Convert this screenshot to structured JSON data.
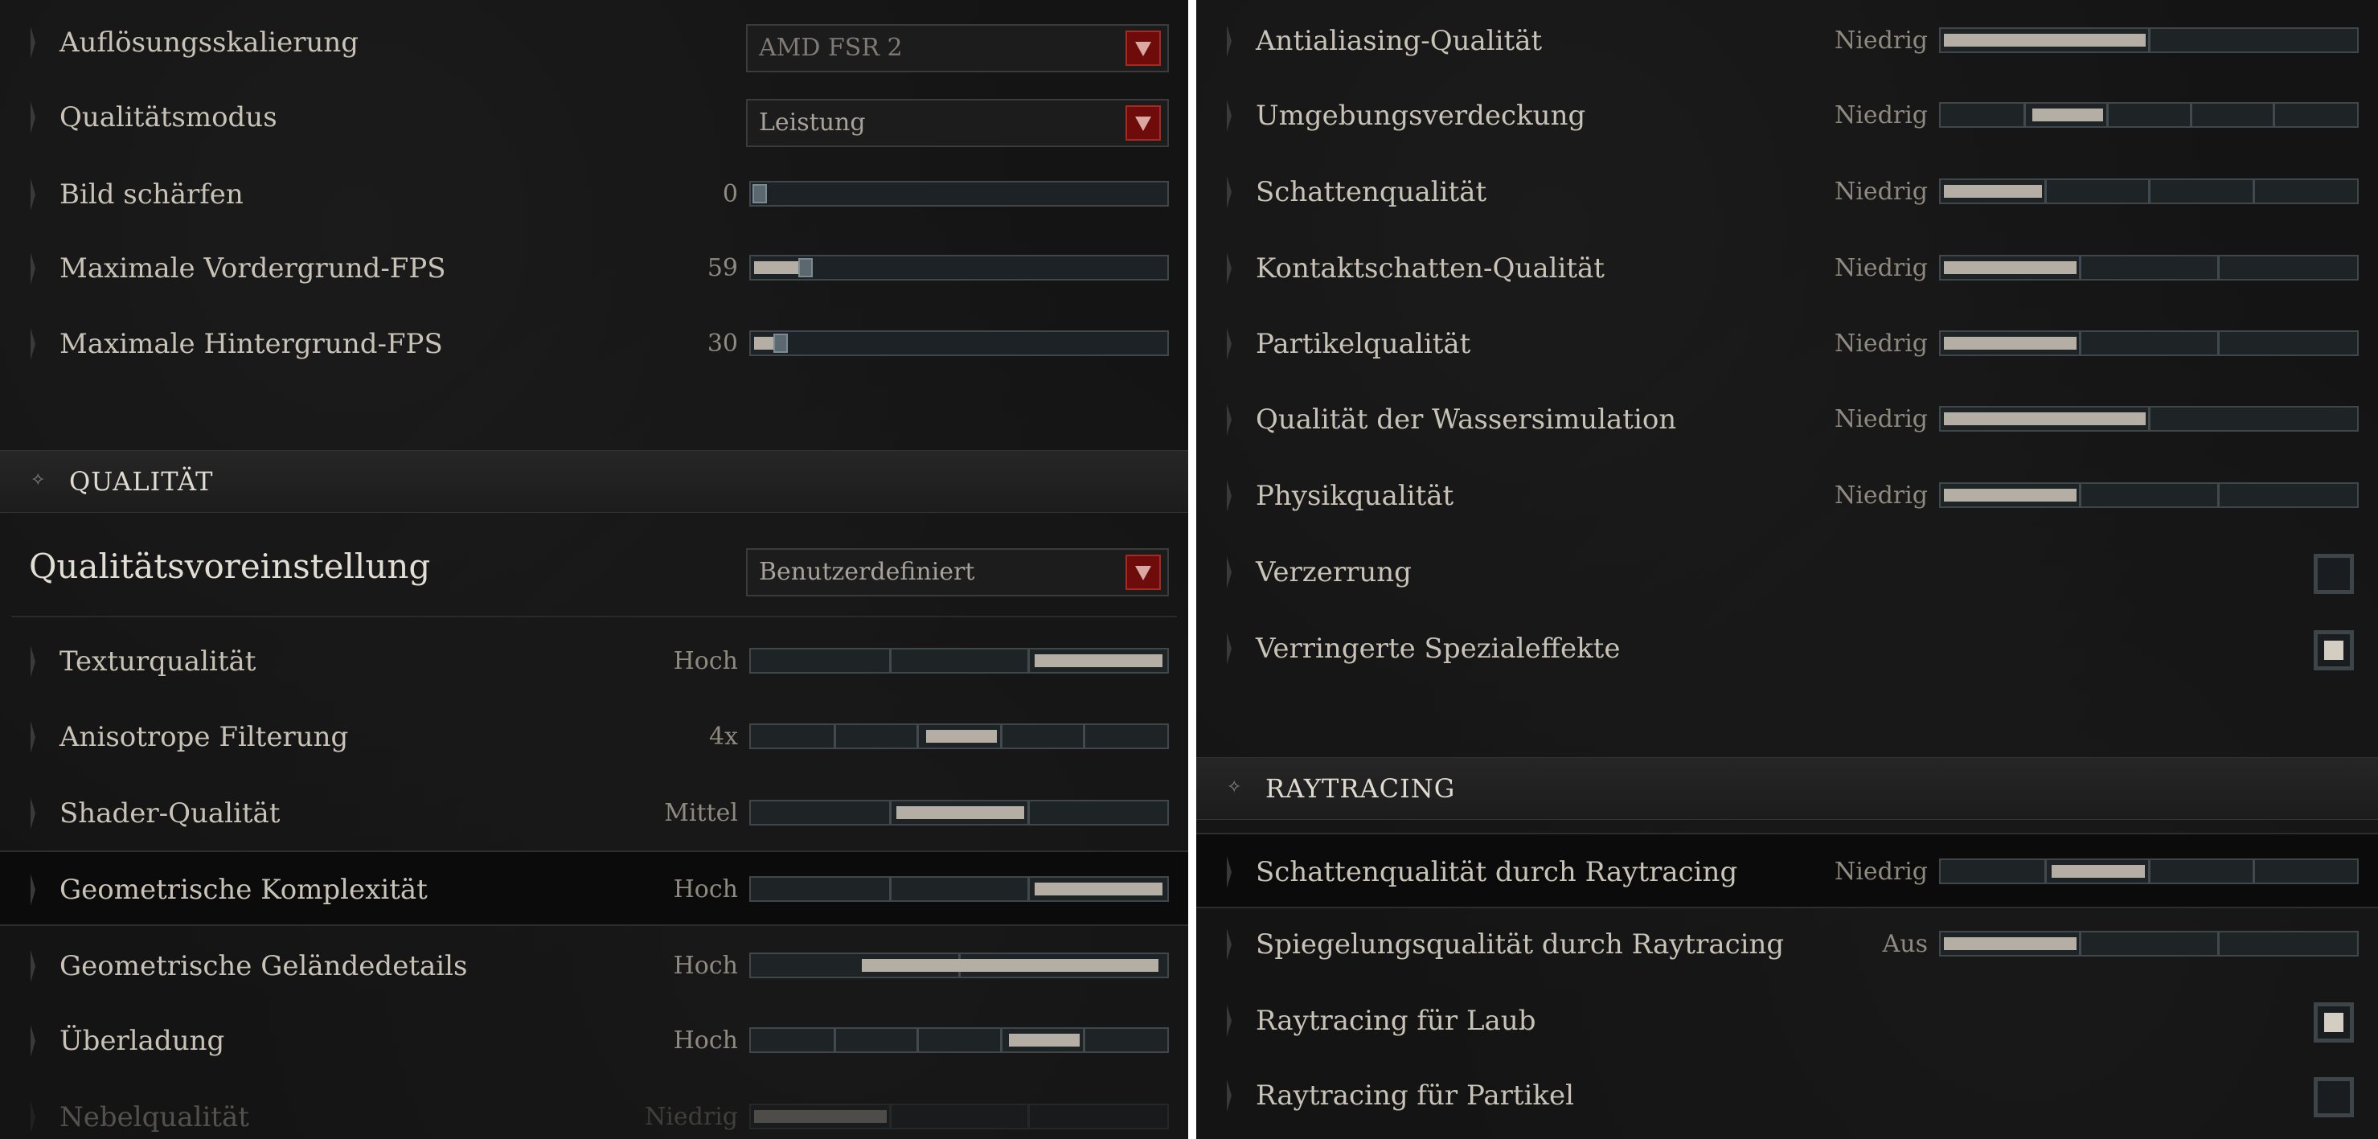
{
  "left": {
    "display_rows": [
      {
        "label": "Auflösungsskalierung",
        "type": "dropdown",
        "value": "AMD FSR 2",
        "dim": true
      },
      {
        "label": "Qualitätsmodus",
        "type": "dropdown",
        "value": "Leistung"
      },
      {
        "label": "Bild schärfen",
        "type": "slider",
        "value": "0",
        "fraction": 0.0
      },
      {
        "label": "Maximale Vordergrund-FPS",
        "type": "slider",
        "value": "59",
        "fraction": 0.11
      },
      {
        "label": "Maximale Hintergrund-FPS",
        "type": "slider",
        "value": "30",
        "fraction": 0.05
      }
    ],
    "section_title": "QUALITÄT",
    "preset": {
      "label": "Qualitätsvoreinstellung",
      "value": "Benutzerdefiniert"
    },
    "quality_rows": [
      {
        "label": "Texturqualität",
        "value": "Hoch",
        "segments": 3,
        "level": 3
      },
      {
        "label": "Anisotrope Filterung",
        "value": "4x",
        "segments": 5,
        "level": 3
      },
      {
        "label": "Shader-Qualität",
        "value": "Mittel",
        "segments": 3,
        "level": 2
      },
      {
        "label": "Geometrische Komplexität",
        "value": "Hoch",
        "segments": 3,
        "level": 3,
        "highlight": true
      },
      {
        "label": "Geometrische Geländedetails",
        "value": "Hoch",
        "segments": 2,
        "level": 2
      },
      {
        "label": "Überladung",
        "value": "Hoch",
        "segments": 5,
        "level": 4
      },
      {
        "label": "Nebelqualität",
        "value": "Niedrig",
        "segments": 3,
        "level": 1,
        "faded": true
      }
    ]
  },
  "right": {
    "quality_rows": [
      {
        "label": "Antialiasing-Qualität",
        "value": "Niedrig",
        "segments": 2,
        "level": 1
      },
      {
        "label": "Umgebungsverdeckung",
        "value": "Niedrig",
        "segments": 5,
        "level": 2
      },
      {
        "label": "Schattenqualität",
        "value": "Niedrig",
        "segments": 4,
        "level": 1
      },
      {
        "label": "Kontaktschatten-Qualität",
        "value": "Niedrig",
        "segments": 3,
        "level": 1
      },
      {
        "label": "Partikelqualität",
        "value": "Niedrig",
        "segments": 3,
        "level": 1
      },
      {
        "label": "Qualität der Wassersimulation",
        "value": "Niedrig",
        "segments": 2,
        "level": 1
      },
      {
        "label": "Physikqualität",
        "value": "Niedrig",
        "segments": 3,
        "level": 1
      }
    ],
    "checkbox_rows": [
      {
        "label": "Verzerrung",
        "checked": false
      },
      {
        "label": "Verringerte Spezialeffekte",
        "checked": true
      }
    ],
    "section_title": "RAYTRACING",
    "rt_rows": [
      {
        "label": "Schattenqualität durch Raytracing",
        "value": "Niedrig",
        "segments": 4,
        "level": 2,
        "highlight": true
      },
      {
        "label": "Spiegelungsqualität durch Raytracing",
        "value": "Aus",
        "segments": 3,
        "level": 1
      }
    ],
    "rt_checkboxes": [
      {
        "label": "Raytracing für Laub",
        "checked": true
      },
      {
        "label": "Raytracing für Partikel",
        "checked": false
      }
    ]
  },
  "icons": {
    "section": "diamond-cross-icon",
    "dropdown": "triangle-down-icon"
  },
  "colors": {
    "accent_red": "#6e0c0c",
    "fill": "#b4aea4",
    "bg": "#141414"
  }
}
